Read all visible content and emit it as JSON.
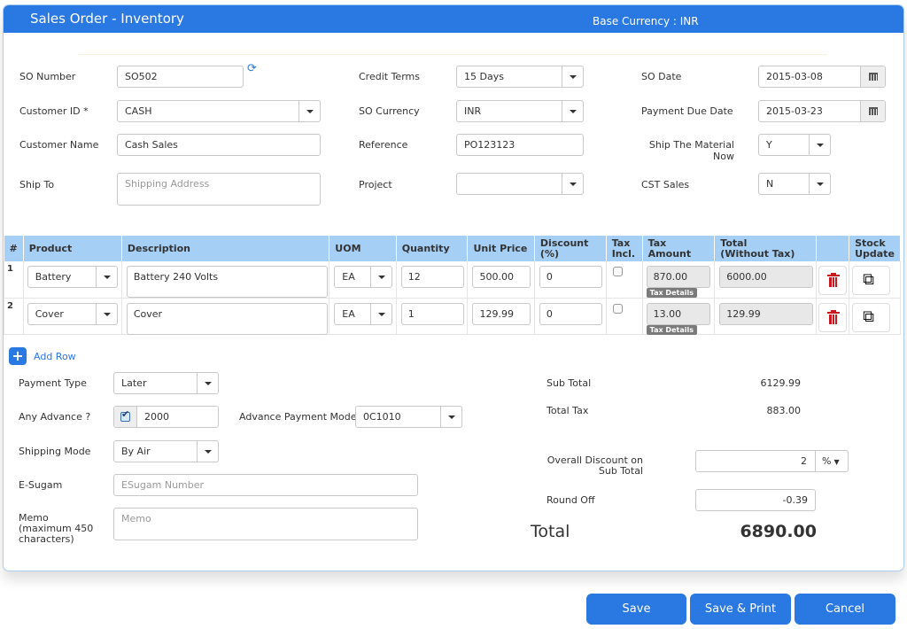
{
  "header": {
    "title": "Sales Order - Inventory",
    "base_currency": "Base Currency : INR"
  },
  "form": {
    "so_number": {
      "label": "SO Number",
      "value": "SO502"
    },
    "customer_id": {
      "label": "Customer ID *",
      "value": "CASH"
    },
    "customer_name": {
      "label": "Customer Name",
      "value": "Cash Sales"
    },
    "ship_to": {
      "label": "Ship To",
      "placeholder": "Shipping Address"
    },
    "credit_terms": {
      "label": "Credit Terms",
      "value": "15 Days"
    },
    "so_currency": {
      "label": "SO Currency",
      "value": "INR"
    },
    "reference": {
      "label": "Reference",
      "value": "PO123123"
    },
    "project": {
      "label": "Project",
      "value": ""
    },
    "so_date": {
      "label": "SO Date",
      "value": "2015-03-08"
    },
    "payment_due_date": {
      "label": "Payment Due Date",
      "value": "2015-03-23"
    },
    "ship_material_now": {
      "label_line1": "Ship The Material",
      "label_line2": "Now",
      "value": "Y"
    },
    "cst_sales": {
      "label": "CST Sales",
      "value": "N"
    }
  },
  "table": {
    "columns": {
      "num": "#",
      "product": "Product",
      "description": "Description",
      "uom": "UOM",
      "quantity": "Quantity",
      "unit_price": "Unit Price",
      "discount_l1": "Discount",
      "discount_l2": "(%)",
      "tax_incl_l1": "Tax",
      "tax_incl_l2": "Incl.",
      "tax_amount_l1": "Tax",
      "tax_amount_l2": "Amount",
      "total_l1": "Total",
      "total_l2": "(Without Tax)",
      "stock_l1": "Stock",
      "stock_l2": "Update"
    },
    "tax_details_label": "Tax Details",
    "rows": [
      {
        "num": "1",
        "product": "Battery",
        "description": "Battery 240 Volts",
        "uom": "EA",
        "quantity": "12",
        "unit_price": "500.00",
        "discount": "0",
        "tax_incl": false,
        "tax_amount": "870.00",
        "total": "6000.00"
      },
      {
        "num": "2",
        "product": "Cover",
        "description": "Cover",
        "uom": "EA",
        "quantity": "1",
        "unit_price": "129.99",
        "discount": "0",
        "tax_incl": false,
        "tax_amount": "13.00",
        "total": "129.99"
      }
    ],
    "add_row_label": "Add Row"
  },
  "footer_form": {
    "payment_type": {
      "label": "Payment Type",
      "value": "Later"
    },
    "any_advance": {
      "label": "Any Advance ?",
      "checked": true,
      "value": "2000"
    },
    "advance_payment_mode": {
      "label": "Advance Payment Mode",
      "value": "0C1010"
    },
    "shipping_mode": {
      "label": "Shipping Mode",
      "value": "By Air"
    },
    "e_sugam": {
      "label": "E-Sugam",
      "placeholder": "ESugam Number"
    },
    "memo": {
      "label_l1": "Memo",
      "label_l2": "(maximum 450",
      "label_l3": "characters)",
      "placeholder": "Memo"
    }
  },
  "summary": {
    "sub_total": {
      "label": "Sub Total",
      "value": "6129.99"
    },
    "total_tax": {
      "label": "Total Tax",
      "value": "883.00"
    },
    "overall_discount": {
      "label_l1": "Overall Discount on",
      "label_l2": "Sub Total",
      "value": "2",
      "unit": "%"
    },
    "round_off": {
      "label": "Round Off",
      "value": "-0.39"
    },
    "total": {
      "label": "Total",
      "value": "6890.00"
    }
  },
  "buttons": {
    "save": "Save",
    "save_print": "Save & Print",
    "cancel": "Cancel"
  },
  "colors": {
    "primary": "#2a78e2",
    "table_header": "#a6cff6",
    "delete": "#c9171d"
  }
}
